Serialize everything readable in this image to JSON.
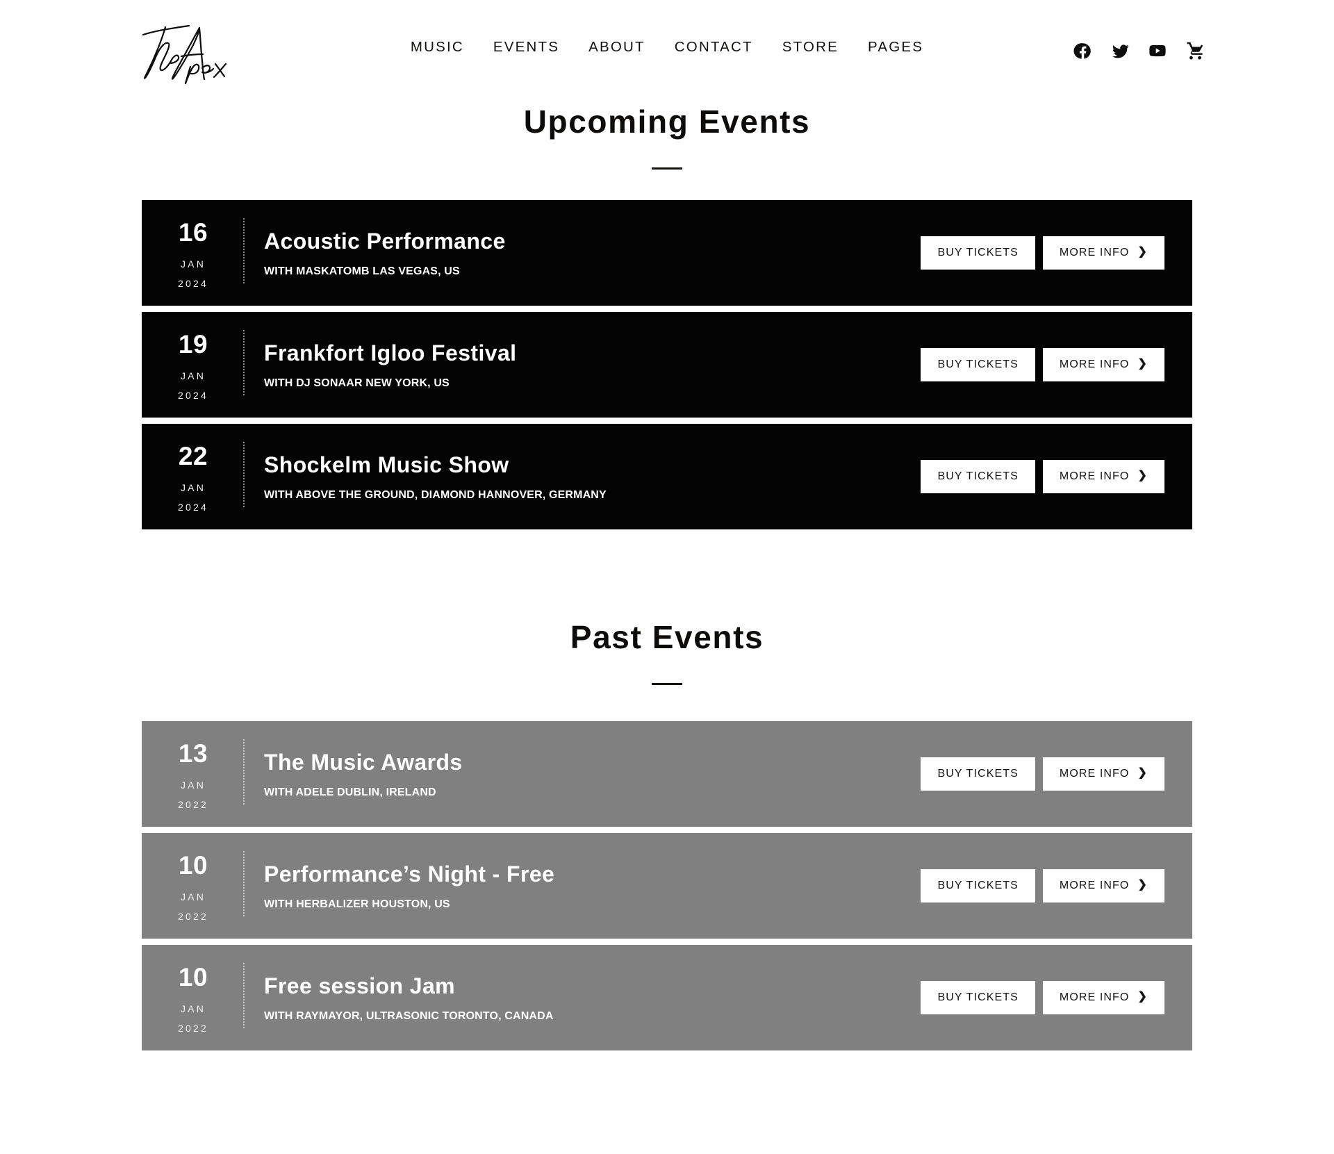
{
  "header": {
    "logo_text": "The Apex",
    "logo_name": "the-apex-signature-logo",
    "nav": [
      {
        "label": "MUSIC",
        "key": "music"
      },
      {
        "label": "EVENTS",
        "key": "events"
      },
      {
        "label": "ABOUT",
        "key": "about"
      },
      {
        "label": "CONTACT",
        "key": "contact"
      },
      {
        "label": "STORE",
        "key": "store"
      },
      {
        "label": "PAGES",
        "key": "pages"
      }
    ],
    "social": [
      {
        "icon": "facebook-icon",
        "label": "Facebook"
      },
      {
        "icon": "twitter-icon",
        "label": "Twitter"
      },
      {
        "icon": "youtube-icon",
        "label": "YouTube"
      },
      {
        "icon": "shopping-cart-icon",
        "label": "Cart"
      }
    ]
  },
  "upcoming": {
    "title": "Upcoming Events",
    "events": [
      {
        "day": "16",
        "month": "JAN",
        "year": "2024",
        "name": "Acoustic Performance",
        "meta": "WITH MASKATOMB LAS VEGAS, US",
        "buy_label": "BUY TICKETS",
        "info_label": "MORE INFO"
      },
      {
        "day": "19",
        "month": "JAN",
        "year": "2024",
        "name": "Frankfort Igloo Festival",
        "meta": "WITH DJ SONAAR NEW YORK, US",
        "buy_label": "BUY TICKETS",
        "info_label": "MORE INFO"
      },
      {
        "day": "22",
        "month": "JAN",
        "year": "2024",
        "name": "Shockelm Music Show",
        "meta": "WITH ABOVE THE GROUND, DIAMOND HANNOVER, GERMANY",
        "buy_label": "BUY TICKETS",
        "info_label": "MORE INFO"
      }
    ]
  },
  "past": {
    "title": "Past Events",
    "events": [
      {
        "day": "13",
        "month": "JAN",
        "year": "2022",
        "name": "The Music Awards",
        "meta": "WITH ADELE DUBLIN, IRELAND",
        "buy_label": "BUY TICKETS",
        "info_label": "MORE INFO"
      },
      {
        "day": "10",
        "month": "JAN",
        "year": "2022",
        "name": "Performance’s Night - Free",
        "meta": "WITH HERBALIZER HOUSTON, US",
        "buy_label": "BUY TICKETS",
        "info_label": "MORE INFO"
      },
      {
        "day": "10",
        "month": "JAN",
        "year": "2022",
        "name": "Free session Jam",
        "meta": "WITH RAYMAYOR, ULTRASONIC TORONTO, CANADA",
        "buy_label": "BUY TICKETS",
        "info_label": "MORE INFO"
      }
    ]
  },
  "colors": {
    "page_background": "#ffffff",
    "upcoming_card": "#030303",
    "past_card": "#808080",
    "button_background": "#ffffff",
    "button_text": "#141414",
    "text_dark": "#0d0c0b",
    "text_light": "#ffffff"
  },
  "chevron_glyph": "❯"
}
